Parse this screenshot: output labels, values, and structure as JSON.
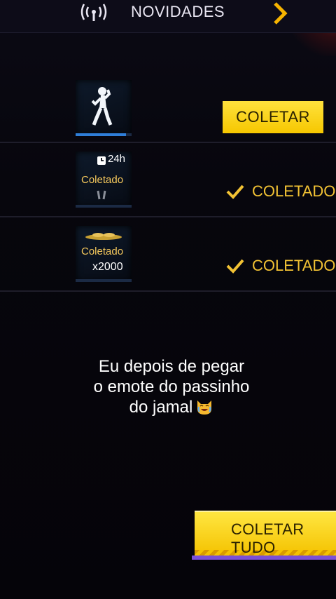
{
  "header": {
    "title": "NOVIDADES",
    "left_icon": "signal-broadcast-icon",
    "right_icon": "chevron-right-icon"
  },
  "rewards": [
    {
      "thumb_icon": "dancing-figure-icon",
      "progress": 0.9,
      "action_label": "COLETAR",
      "status": "collect"
    },
    {
      "thumb_icon": "clock-icon",
      "thumb_timer": "24h",
      "thumb_label": "Coletado",
      "status_label": "COLETADO",
      "status": "collected"
    },
    {
      "thumb_icon": "gold-coins-icon",
      "thumb_label": "Coletado",
      "thumb_amount": "x2000",
      "status_label": "COLETADO",
      "status": "collected"
    }
  ],
  "caption": {
    "line1": "Eu depois de pegar",
    "line2": "o emote do passinho",
    "line3": "do jamal",
    "emoji": "laughing-cat-emoji-icon"
  },
  "footer": {
    "collect_all_label": "COLETAR TUDO"
  },
  "colors": {
    "accent_yellow": "#f6c700",
    "status_gold": "#f2c234",
    "progress_blue": "#2f7ed8",
    "background": "#07060d"
  }
}
